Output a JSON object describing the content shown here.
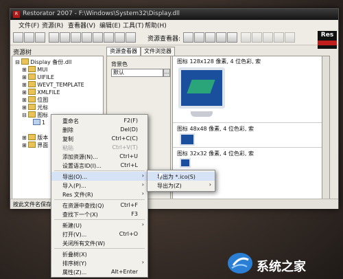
{
  "window": {
    "title": "Restorator 2007 - F:\\Windows\\System32\\Display.dll"
  },
  "menu": [
    "文件(F)",
    "资源(R)",
    "查看器(V)",
    "编辑(E)",
    "工具(T)",
    "帮助(H)"
  ],
  "toolbar": {
    "viewer_label": "资源查看器:",
    "logo": "Res"
  },
  "left_panel": {
    "title": "资源树"
  },
  "tree": {
    "root": "Display 备份.dll",
    "items": [
      "MUI",
      "UIFILE",
      "WEVT_TEMPLATE",
      "XMLFILE",
      "位图",
      "光标",
      "图标",
      "版本",
      "界面"
    ],
    "sub_items": [
      "1"
    ]
  },
  "tabs": [
    "资源查看器",
    "文件浏览器"
  ],
  "background_panel": {
    "label": "背景色",
    "value": "默认",
    "button": "..."
  },
  "icon_list": [
    "图标 128x128 像素, 4 位色彩, 索",
    "图标 48x48 像素, 4 位色彩, 索",
    "图标 32x32 像素, 4 位色彩, 索"
  ],
  "status": {
    "text": "按此文件名保存"
  },
  "context_menu": {
    "items": [
      {
        "label": "重命名",
        "shortcut": "F2(F)",
        "disabled": false
      },
      {
        "label": "删除",
        "shortcut": "Del(D)",
        "disabled": false
      },
      {
        "label": "复制",
        "shortcut": "Ctrl+C(C)",
        "disabled": false
      },
      {
        "label": "粘贴",
        "shortcut": "Ctrl+V(T)",
        "disabled": true
      },
      {
        "label": "添加资源(N)...",
        "shortcut": "Ctrl+U",
        "disabled": false
      },
      {
        "label": "设置语言ID(I)...",
        "shortcut": "Ctrl+L",
        "disabled": false
      },
      {
        "label": "导出(O)...",
        "shortcut": "",
        "disabled": false
      },
      {
        "label": "导入(P)...",
        "shortcut": "",
        "disabled": false
      },
      {
        "label": "Res 文件(R)",
        "shortcut": "",
        "disabled": false
      },
      {
        "label": "在资源中查找(Q)",
        "shortcut": "Ctrl+F",
        "disabled": false
      },
      {
        "label": "查找下一个(X)",
        "shortcut": "F3",
        "disabled": false
      },
      {
        "label": "新建(U)",
        "shortcut": "",
        "disabled": false
      },
      {
        "label": "打开(V)...",
        "shortcut": "Ctrl+O",
        "disabled": false
      },
      {
        "label": "关闭所有文件(W)",
        "shortcut": "",
        "disabled": false
      },
      {
        "label": "折叠树(X)",
        "shortcut": "",
        "disabled": false
      },
      {
        "label": "排序树(Y)",
        "shortcut": "",
        "disabled": false
      },
      {
        "label": "属性(Z)...",
        "shortcut": "Alt+Enter",
        "disabled": false
      }
    ]
  },
  "export_submenu": [
    "导出为 *.ico(S)",
    "导出为(Z)"
  ],
  "watermark": {
    "text": "系统之家"
  }
}
